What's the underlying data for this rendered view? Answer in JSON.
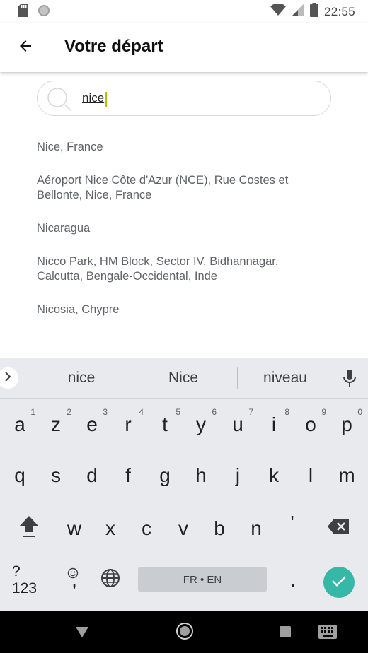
{
  "status_bar": {
    "time": "22:55",
    "icons": [
      "sd-card-icon",
      "circle-notification-icon",
      "wifi-icon",
      "cell-signal-icon",
      "battery-icon"
    ]
  },
  "app_bar": {
    "title": "Votre départ",
    "back_icon": "arrow-left-icon"
  },
  "search": {
    "value": "nice",
    "icon": "search-icon"
  },
  "results": [
    {
      "line1": "Nice, France",
      "line2": ""
    },
    {
      "line1": "Aéroport Nice Côte d'Azur (NCE), Rue Costes et",
      "line2": "Bellonte, Nice, France"
    },
    {
      "line1": "Nicaragua",
      "line2": ""
    },
    {
      "line1": "Nicco Park, HM Block, Sector IV, Bidhannagar,",
      "line2": "Calcutta, Bengale-Occidental, Inde"
    },
    {
      "line1": "Nicosia, Chypre",
      "line2": ""
    }
  ],
  "keyboard": {
    "suggestions": [
      "nice",
      "Nice",
      "niveau"
    ],
    "row1": [
      "a",
      "z",
      "e",
      "r",
      "t",
      "y",
      "u",
      "i",
      "o",
      "p"
    ],
    "row1_hints": [
      "1",
      "2",
      "3",
      "4",
      "5",
      "6",
      "7",
      "8",
      "9",
      "0"
    ],
    "row2": [
      "q",
      "s",
      "d",
      "f",
      "g",
      "h",
      "j",
      "k",
      "l",
      "m"
    ],
    "row3": [
      "w",
      "x",
      "c",
      "v",
      "b",
      "n",
      "'"
    ],
    "symbols_label": "?123",
    "comma": ",",
    "period": ".",
    "space_label": "FR • EN"
  },
  "colors": {
    "accent": "#35b8a6",
    "caret": "#b5c400",
    "keyboard_bg": "#e8eaed"
  }
}
